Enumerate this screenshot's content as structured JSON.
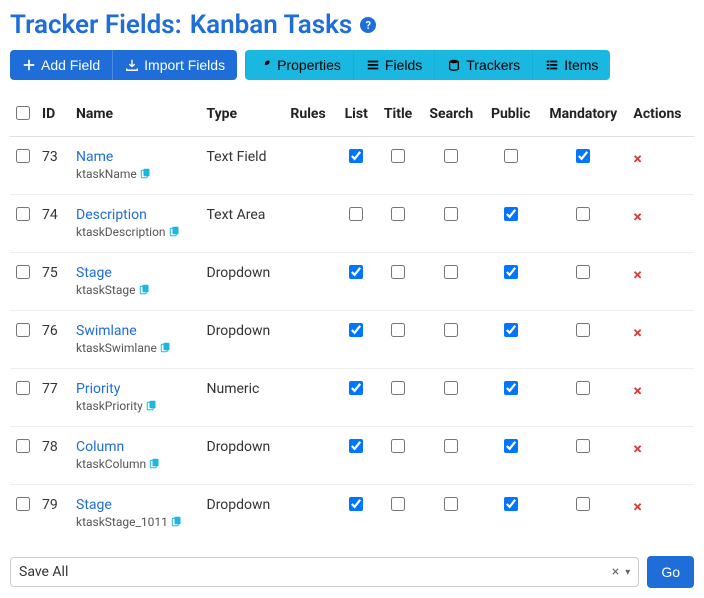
{
  "title_prefix": "Tracker Fields: ",
  "title_name": "Kanban Tasks",
  "toolbar": {
    "add_field": "Add Field",
    "import_fields": "Import Fields",
    "properties": "Properties",
    "fields": "Fields",
    "trackers": "Trackers",
    "items": "Items"
  },
  "columns": {
    "id": "ID",
    "name": "Name",
    "type": "Type",
    "rules": "Rules",
    "list": "List",
    "title": "Title",
    "search": "Search",
    "public": "Public",
    "mandatory": "Mandatory",
    "actions": "Actions"
  },
  "rows": [
    {
      "id": "73",
      "name": "Name",
      "perm": "ktaskName",
      "type": "Text Field",
      "list": true,
      "title": false,
      "search": false,
      "public": false,
      "mandatory": true
    },
    {
      "id": "74",
      "name": "Description",
      "perm": "ktaskDescription",
      "type": "Text Area",
      "list": false,
      "title": false,
      "search": false,
      "public": true,
      "mandatory": false
    },
    {
      "id": "75",
      "name": "Stage",
      "perm": "ktaskStage",
      "type": "Dropdown",
      "list": true,
      "title": false,
      "search": false,
      "public": true,
      "mandatory": false
    },
    {
      "id": "76",
      "name": "Swimlane",
      "perm": "ktaskSwimlane",
      "type": "Dropdown",
      "list": true,
      "title": false,
      "search": false,
      "public": true,
      "mandatory": false
    },
    {
      "id": "77",
      "name": "Priority",
      "perm": "ktaskPriority",
      "type": "Numeric",
      "list": true,
      "title": false,
      "search": false,
      "public": true,
      "mandatory": false
    },
    {
      "id": "78",
      "name": "Column",
      "perm": "ktaskColumn",
      "type": "Dropdown",
      "list": true,
      "title": false,
      "search": false,
      "public": true,
      "mandatory": false
    },
    {
      "id": "79",
      "name": "Stage",
      "perm": "ktaskStage_1011",
      "type": "Dropdown",
      "list": true,
      "title": false,
      "search": false,
      "public": true,
      "mandatory": false
    }
  ],
  "footer": {
    "action_label": "Save All",
    "go": "Go"
  }
}
